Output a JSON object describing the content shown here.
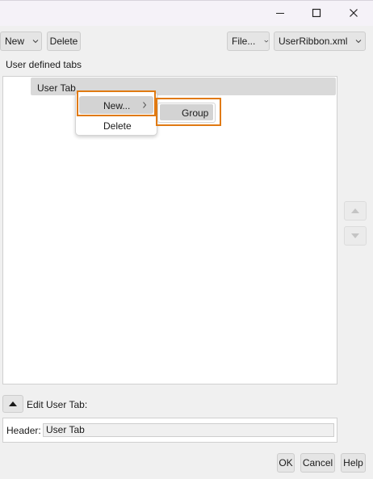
{
  "toolbar": {
    "new_label": "New",
    "delete_label": "Delete",
    "file_label": "File...",
    "ribbon_file_label": "UserRibbon.xml"
  },
  "tree": {
    "section_label": "User defined tabs",
    "items": [
      {
        "label": "User Tab"
      }
    ]
  },
  "context_menu": {
    "items": [
      {
        "label": "New..."
      },
      {
        "label": "Delete"
      }
    ],
    "submenu": {
      "items": [
        {
          "label": "Group"
        }
      ]
    }
  },
  "edit_section": {
    "title": "Edit User Tab:",
    "header_label": "Header:",
    "header_value": "User Tab"
  },
  "footer": {
    "ok_label": "OK",
    "cancel_label": "Cancel",
    "help_label": "Help"
  },
  "colors": {
    "highlight": "#e07a12",
    "selection": "#d9d9d9"
  },
  "icons": {
    "window": [
      "minimize-icon",
      "maximize-icon",
      "close-icon"
    ],
    "dropdown": "chevron-down-icon",
    "submenu": "chevron-right-icon",
    "move": [
      "arrow-up-icon",
      "arrow-down-icon"
    ],
    "collapse": "collapse-up-icon"
  }
}
